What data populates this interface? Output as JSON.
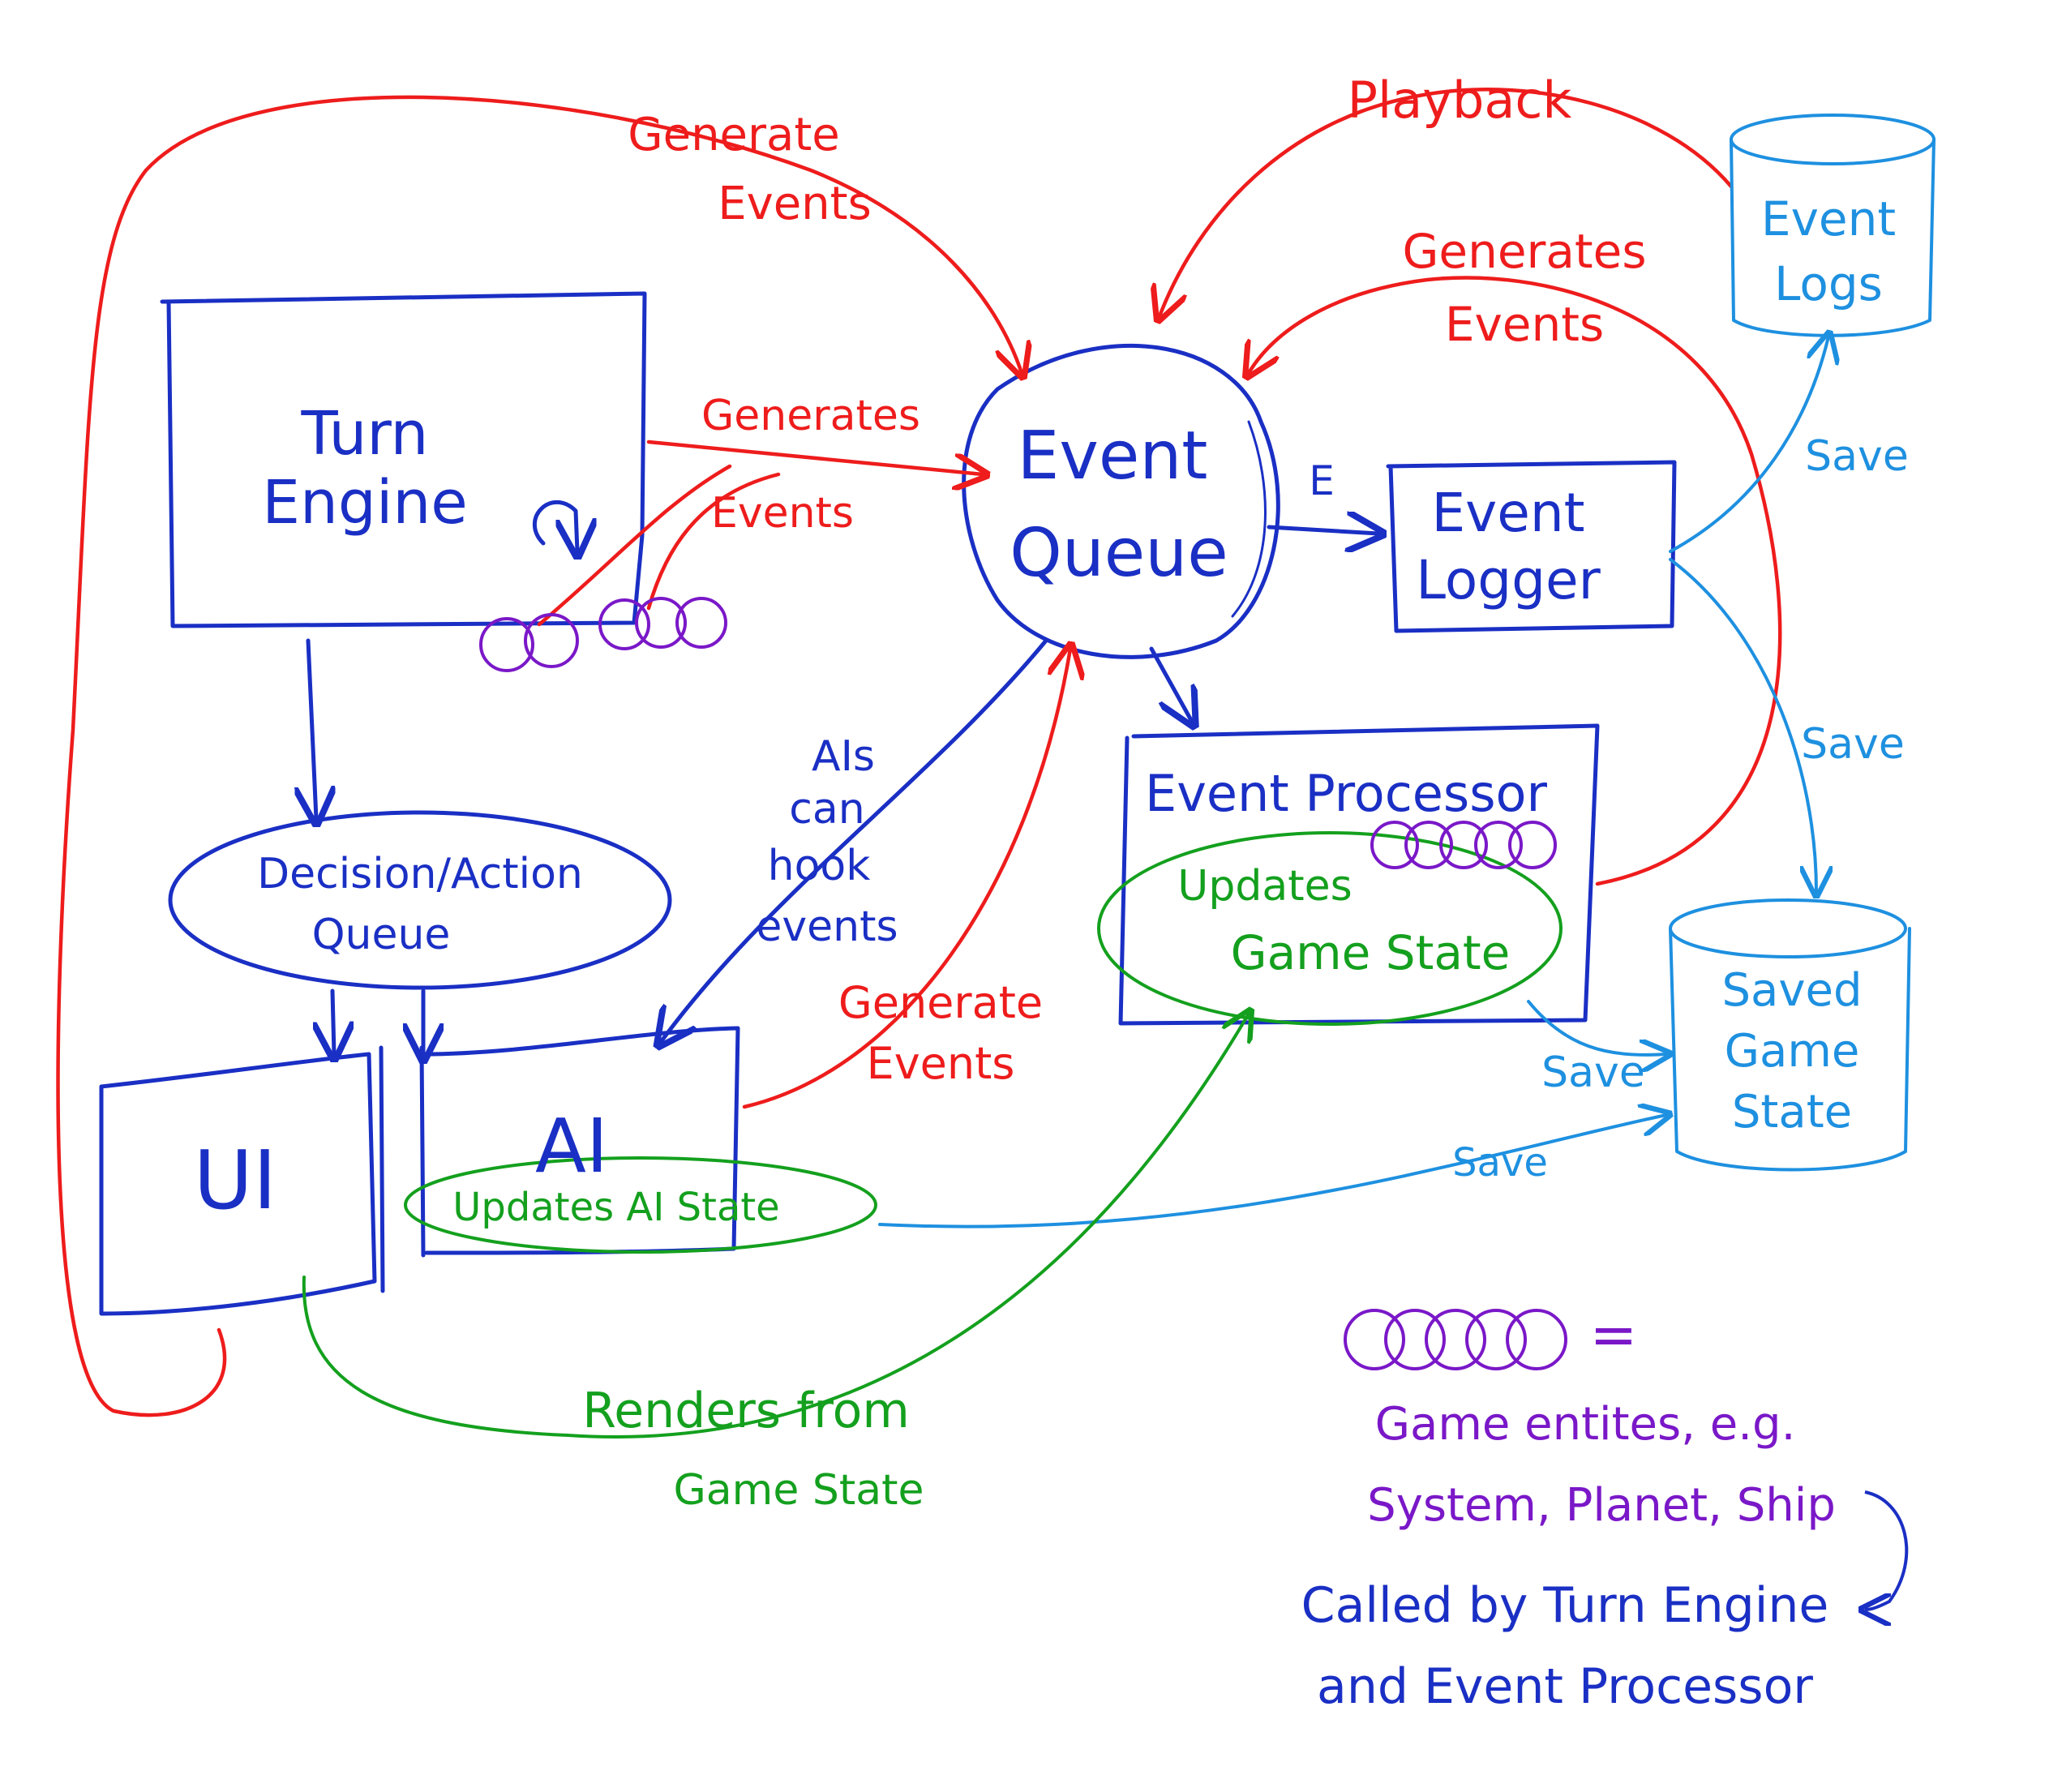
{
  "colors": {
    "blue": "#1a2fc4",
    "red": "#ee1c1c",
    "green": "#14a01e",
    "sky": "#1e90e0",
    "purple": "#7a18c8"
  },
  "nodes": {
    "turn_engine": [
      "Turn",
      "Engine"
    ],
    "decision_queue": [
      "Decision/Action",
      "Queue"
    ],
    "ui": "UI",
    "ai": "AI",
    "ai_state": "Updates AI State",
    "event_queue": [
      "Event",
      "Queue"
    ],
    "event_logger": [
      "Event",
      "Logger"
    ],
    "logger_mark": "E",
    "event_processor": "Event Processor",
    "game_state": [
      "Updates",
      "Game State"
    ],
    "event_logs": [
      "Event",
      "Logs"
    ],
    "saved_state": [
      "Saved",
      "Game",
      "State"
    ]
  },
  "edge_labels": {
    "generate_events_top": [
      "Generate",
      "Events"
    ],
    "generates_events_turn": [
      "Generates",
      "Events"
    ],
    "playback": "Playback",
    "generates_events_right": [
      "Generates",
      "Events"
    ],
    "generate_events_ai": [
      "Generate",
      "Events"
    ],
    "ais_hook_events": [
      "AIs",
      "can",
      "hook",
      "events"
    ],
    "save_logs": "Save",
    "save_right": "Save",
    "save_processor": "Save",
    "save_ai": "Save",
    "renders": [
      "Renders from",
      "Game State"
    ]
  },
  "legend": {
    "equals": "=",
    "lines": [
      "Game entites, e.g.",
      "System, Planet, Ship",
      "Called by Turn Engine",
      "and Event Processor"
    ]
  }
}
